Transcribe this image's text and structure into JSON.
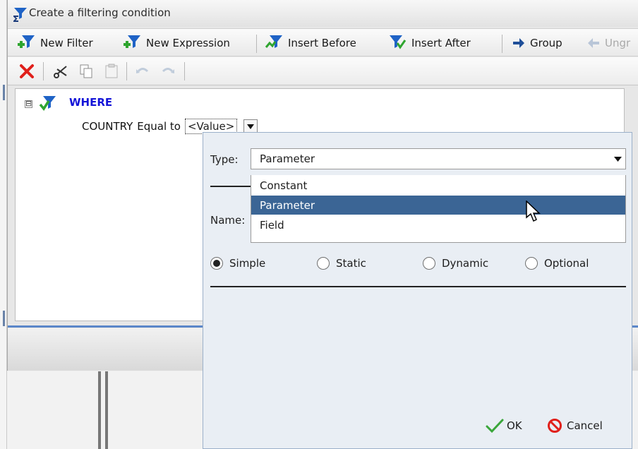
{
  "window": {
    "title": "Create a filtering condition"
  },
  "toolbar": {
    "new_filter": "New Filter",
    "new_expression": "New Expression",
    "insert_before": "Insert Before",
    "insert_after": "Insert After",
    "group": "Group",
    "ungroup": "Ungr"
  },
  "edit_toolbar": {
    "icons": [
      "delete-icon",
      "cut-icon",
      "copy-icon",
      "paste-icon",
      "undo-icon",
      "redo-icon"
    ]
  },
  "tree": {
    "expander": "⊟",
    "where_label": "WHERE",
    "condition": {
      "field": "COUNTRY",
      "operator": "Equal to",
      "value": "<Value>"
    }
  },
  "popup": {
    "type_label": "Type:",
    "type_value": "Parameter",
    "name_label": "Name:",
    "options": [
      "Constant",
      "Parameter",
      "Field"
    ],
    "selected_option": "Parameter",
    "radios": [
      {
        "label": "Simple",
        "checked": true
      },
      {
        "label": "Static",
        "checked": false
      },
      {
        "label": "Dynamic",
        "checked": false
      },
      {
        "label": "Optional",
        "checked": false
      }
    ],
    "ok_label": "OK",
    "cancel_label": "Cancel"
  },
  "colors": {
    "where_blue": "#1414d8",
    "selection_blue": "#3b6595",
    "accent_line": "#5b87c9",
    "delete_red": "#e0201b",
    "ok_green": "#3aa63a"
  }
}
